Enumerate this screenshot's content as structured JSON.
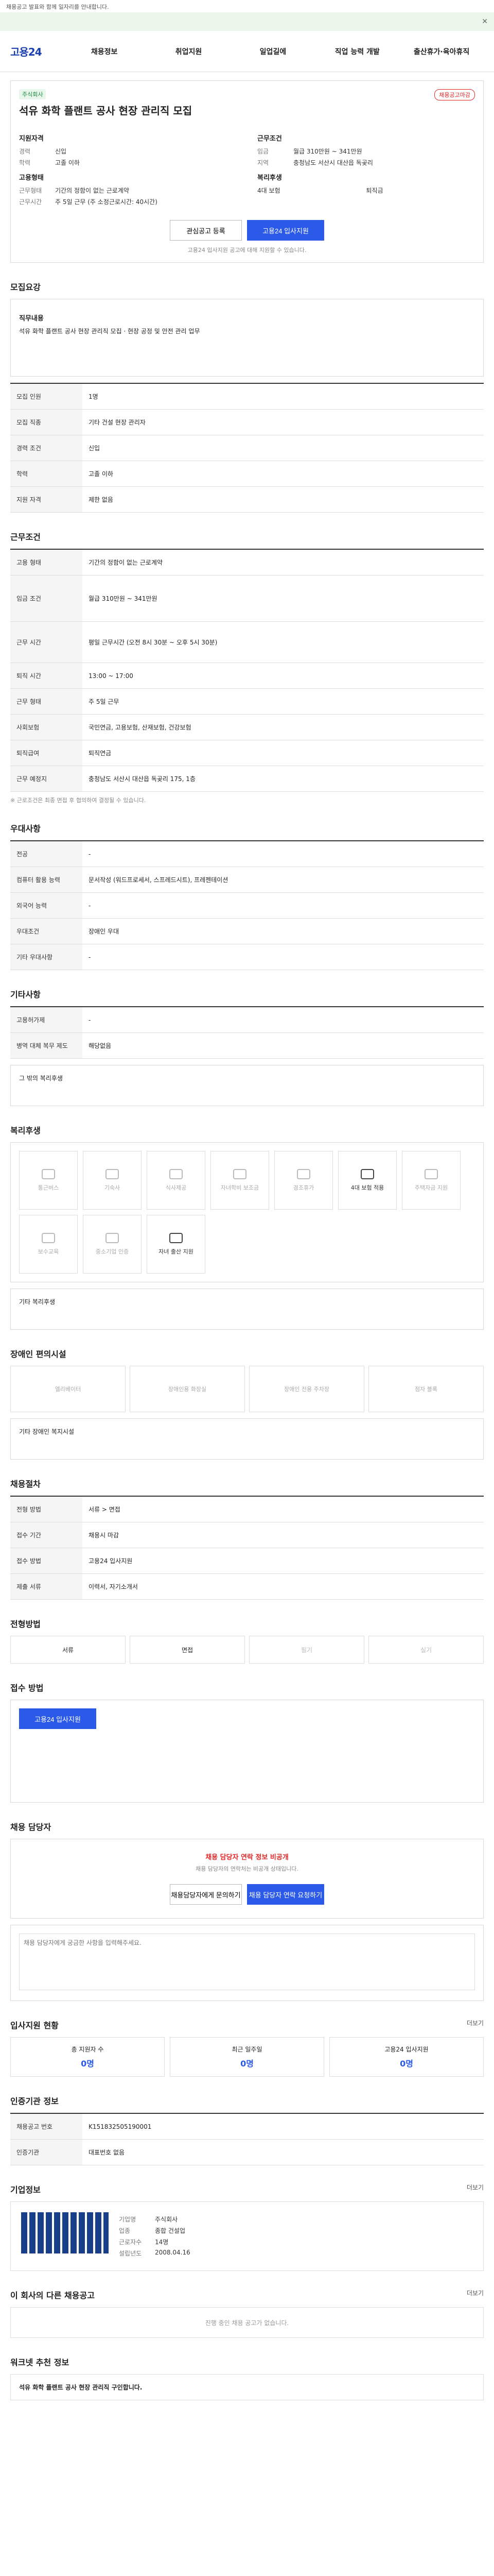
{
  "top_notice": "채용공고 발표와 함께 일자리를 안내합니다.",
  "brand": "고용24",
  "gnb": [
    "채용정보",
    "취업지원",
    "일업길에",
    "직업 능력 개발",
    "출산휴가·육아휴직"
  ],
  "job": {
    "company": "주식회사",
    "hire_badge": "채용공고마감",
    "title": "석유 화학 플랜트 공사 현장 관리직 모집",
    "summary_title": "지원자격",
    "cond_title": "근무조건",
    "left": [
      [
        "경력",
        "신입"
      ],
      [
        "학력",
        "고졸 이하"
      ]
    ],
    "right": [
      [
        "임금",
        "월급 310만원 ~ 341만원"
      ],
      [
        "지역",
        "충청남도 서산시 대산읍 독곶리"
      ]
    ],
    "emp_title": "고용형태",
    "emp": [
      [
        "근무형태",
        "기간의 정함이 없는 근로계약"
      ],
      [
        "근무시간",
        "주 5일 근무 (주 소정근로시간: 40시간)"
      ]
    ],
    "welfare_title": "복리후생",
    "welfare": [
      "4대 보험",
      "퇴직금"
    ],
    "btn_save": "관심공고 등록",
    "btn_apply": "고용24 입사지원",
    "note": "고용24 입사지원 공고에 대해 지원할 수 있습니다."
  },
  "sec1": "모집요강",
  "duty_title": "직무내용",
  "duty": "석유 화학 플랜트 공사 현장 관리직 모집 · 현장 공정 및 안전 관리 업무",
  "recruit": [
    [
      "모집 인원",
      "1명"
    ],
    [
      "모집 직종",
      "기타 건설 현장 관리자"
    ],
    [
      "경력 조건",
      "신입"
    ],
    [
      "학력",
      "고졸 이하"
    ],
    [
      "지원 자격",
      "제한 없음"
    ]
  ],
  "sec2": "근무조건",
  "work": [
    [
      "고용 형태",
      "기간의 정함이 없는 근로계약"
    ],
    [
      "임금 조건",
      "월급 310만원 ~ 341만원"
    ],
    [
      "근무 시간",
      "평일 근무시간 (오전 8시 30분 ~ 오후 5시 30분)"
    ],
    [
      "퇴직 시간",
      "13:00 ~ 17:00"
    ],
    [
      "근무 형태",
      "주 5일 근무"
    ],
    [
      "사회보험",
      "국민연금, 고용보험, 산재보험, 건강보험"
    ],
    [
      "퇴직급여",
      "퇴직연금"
    ],
    [
      "근무 예정지",
      "충청남도 서산시 대산읍 독곶리 175, 1층"
    ]
  ],
  "work_note": "※ 근로조건은 최종 면접 후 협의하여 결정될 수 있습니다.",
  "sec3": "우대사항",
  "pref": [
    [
      "전공",
      "-"
    ],
    [
      "컴퓨터 활용 능력",
      "문서작성 (워드프로세서, 스프레드시트), 프레젠테이션"
    ],
    [
      "외국어 능력",
      "-"
    ],
    [
      "우대조건",
      "장애인 우대"
    ],
    [
      "기타 우대사항",
      "-"
    ]
  ],
  "sec4": "기타사항",
  "etc": [
    [
      "고용허가제",
      "-"
    ],
    [
      "병역 대체 복무 제도",
      "해당없음"
    ]
  ],
  "etc_more": "그 밖의 복리후생",
  "sec5": "복리후생",
  "welfare_icons": [
    "통근버스",
    "기숙사",
    "식사제공",
    "자녀학비 보조금",
    "경조휴가",
    "4대 보험 적용",
    "주택자금 지원",
    "보수교육",
    "중소기업 인증",
    "자녀 출산 지원"
  ],
  "welfare_extra": "기타 복리후생",
  "sec6": "장애인 편의시설",
  "facility": [
    "엘리베이터",
    "장애인용 화장실",
    "장애인 전용 주차장",
    "점자 블록"
  ],
  "facility_extra": "기타 장애인 복지시설",
  "sec7": "채용절차",
  "proc": [
    [
      "전형 방법",
      "서류 > 면접"
    ],
    [
      "접수 기간",
      "채용시 마감"
    ],
    [
      "접수 방법",
      "고용24 입사지원"
    ],
    [
      "제출 서류",
      "이력서, 자기소개서"
    ]
  ],
  "sec8": "전형방법",
  "method": [
    "서류",
    "면접",
    "필기",
    "실기"
  ],
  "sec9": "접수 방법",
  "apply_btn": "고용24 입사지원",
  "sec10": "채용 담당자",
  "alert": "채용 담당자 연락 정보 비공개",
  "alert_sub": "채용 담당자의 연락처는 비공개 상태입니다.",
  "btn_contact1": "채용담당자에게 문의하기",
  "btn_contact2": "채용 담당자 연락 요청하기",
  "inquiry_ph": "채용 담당자에게 궁금한 사항을 입력해주세요.",
  "sec11": "입사지원 현황",
  "stat": [
    [
      "총 지원자 수",
      "0명"
    ],
    [
      "최근 일주일",
      "0명"
    ],
    [
      "고용24 입사지원",
      "0명"
    ]
  ],
  "sec12": "인증기관 정보",
  "org": [
    [
      "채용공고 번호",
      "K151832505190001"
    ],
    [
      "인증기관",
      "대표번호 없음"
    ]
  ],
  "sec13": "기업정보",
  "ent": [
    [
      "기업명",
      "주식회사"
    ],
    [
      "업종",
      "종합 건설업"
    ],
    [
      "근로자수",
      "14명"
    ],
    [
      "설립년도",
      "2008.04.16"
    ]
  ],
  "sec14": "이 회사의 다른 채용공고",
  "none": "진행 중인 채용 공고가 없습니다.",
  "sec15": "워크넷 추천 정보",
  "rec_title": "석유 화학 플랜트 공사 현장 관리직 구인합니다.",
  "more": "더보기"
}
